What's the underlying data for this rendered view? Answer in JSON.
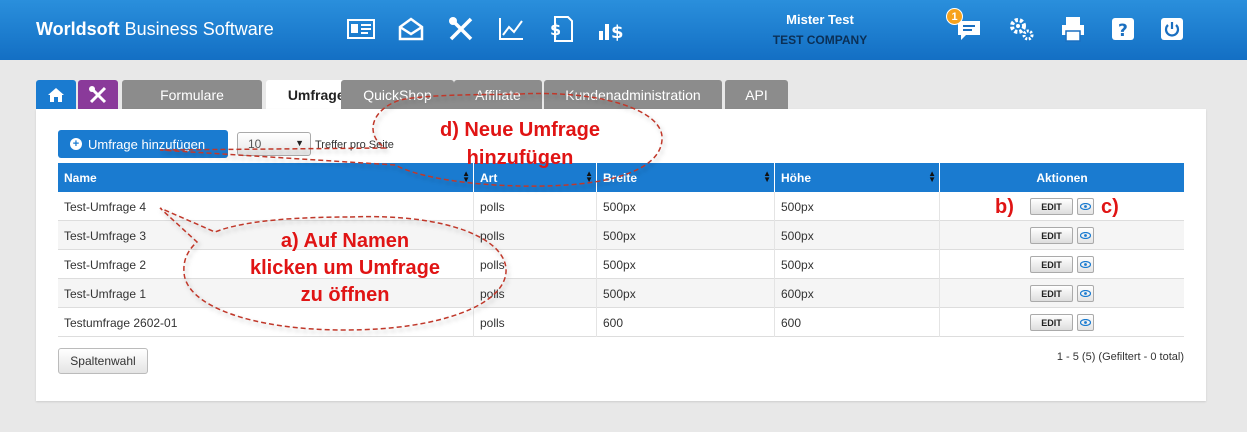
{
  "header": {
    "brand_bold": "Worldsoft",
    "brand_rest": " Business Software",
    "user_name": "Mister Test",
    "company": "TEST COMPANY",
    "notification_count": "1",
    "nav_icons": [
      "contact-card-icon",
      "mail-icon",
      "tools-icon",
      "chart-icon",
      "invoice-icon",
      "sales-icon"
    ],
    "right_icons": [
      "chat-icon",
      "settings-icon",
      "printer-icon",
      "help-icon",
      "power-icon"
    ]
  },
  "tabs": [
    {
      "label": "",
      "icon": "home-icon"
    },
    {
      "label": "",
      "icon": "tools-icon"
    },
    {
      "label": "Formulare"
    },
    {
      "label": "Umfragen",
      "active": true
    },
    {
      "label": "QuickShop"
    },
    {
      "label": "Affiliate"
    },
    {
      "label": "Kundenadministration"
    },
    {
      "label": "API"
    }
  ],
  "toolbar": {
    "add_label": "Umfrage hinzufügen",
    "page_size": "10",
    "page_size_label": "Treffer pro Seite"
  },
  "table": {
    "columns": [
      "Name",
      "Art",
      "Breite",
      "Höhe",
      "Aktionen"
    ],
    "rows": [
      {
        "name": "Test-Umfrage 4",
        "art": "polls",
        "breite": "500px",
        "hoehe": "500px"
      },
      {
        "name": "Test-Umfrage 3",
        "art": "polls",
        "breite": "500px",
        "hoehe": "500px"
      },
      {
        "name": "Test-Umfrage 2",
        "art": "polls",
        "breite": "500px",
        "hoehe": "500px"
      },
      {
        "name": "Test-Umfrage 1",
        "art": "polls",
        "breite": "500px",
        "hoehe": "600px"
      },
      {
        "name": "Testumfrage 2602-01",
        "art": "polls",
        "breite": "600",
        "hoehe": "600"
      }
    ],
    "edit_label": "EDIT"
  },
  "footer": {
    "columns_button": "Spaltenwahl",
    "pager_info": "1 - 5 (5) (Gefiltert - 0 total)"
  },
  "annotations": {
    "d_line1": "d) Neue Umfrage",
    "d_line2": "hinzufügen",
    "a_line1": "a) Auf Namen",
    "a_line2": "klicken um Umfrage",
    "a_line3": "zu öffnen",
    "b": "b)",
    "c": "c)"
  },
  "colors": {
    "header_blue": "#1a7bd0",
    "annotation_red": "#e01414",
    "tab_grey": "#8c8c8c",
    "tools_tab": "#8a3a9a"
  }
}
